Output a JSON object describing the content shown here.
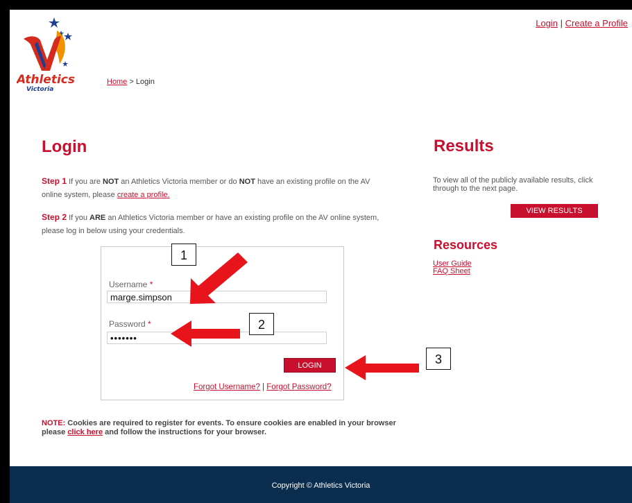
{
  "header": {
    "login_link": "Login",
    "separator": "|",
    "create_profile_link": "Create a Profile"
  },
  "logo": {
    "line1": "Athletics",
    "line2": "Victoria",
    "colors": {
      "red": "#d52b1e",
      "navy": "#1c3f94",
      "orange": "#f39200"
    }
  },
  "breadcrumb": {
    "home": "Home",
    "separator": ">",
    "current": "Login"
  },
  "login": {
    "heading": "Login",
    "step1": {
      "label": "Step 1",
      "text_a": "If you are",
      "bold_a": "NOT",
      "text_b": "an Athletics Victoria member or do",
      "bold_b": "NOT",
      "text_c": "have an existing profile on the AV online system, please",
      "link": "create a profile."
    },
    "step2": {
      "label": "Step 2",
      "text_a": "If you",
      "bold_a": "ARE",
      "text_b": "an Athletics Victoria member or have an existing profile on the AV online system, please log in below using your credentials."
    },
    "form": {
      "username_label": "Username",
      "username_value": "marge.simpson",
      "password_label": "Password",
      "password_value": "•••••••",
      "required_marker": "*",
      "login_button": "LOGIN",
      "forgot_username": "Forgot Username?",
      "forgot_separator": "|",
      "forgot_password": "Forgot Password?"
    },
    "note": {
      "label": "NOTE:",
      "text_a": "Cookies are required to register for events. To ensure cookies are enabled in your browser please",
      "link": "click here",
      "text_b": "and follow the instructions for your browser."
    }
  },
  "results": {
    "heading": "Results",
    "text": "To view all of the publicly available results, click through to the next page.",
    "button": "VIEW RESULTS"
  },
  "resources": {
    "heading": "Resources",
    "links": [
      "User Guide",
      "FAQ Sheet"
    ]
  },
  "footer": {
    "copyright": "Copyright © Athletics Victoria",
    "bg_color": "#0b2e4f"
  },
  "annotations": {
    "callouts": [
      "1",
      "2",
      "3"
    ],
    "arrow_color": "#e8141c"
  }
}
